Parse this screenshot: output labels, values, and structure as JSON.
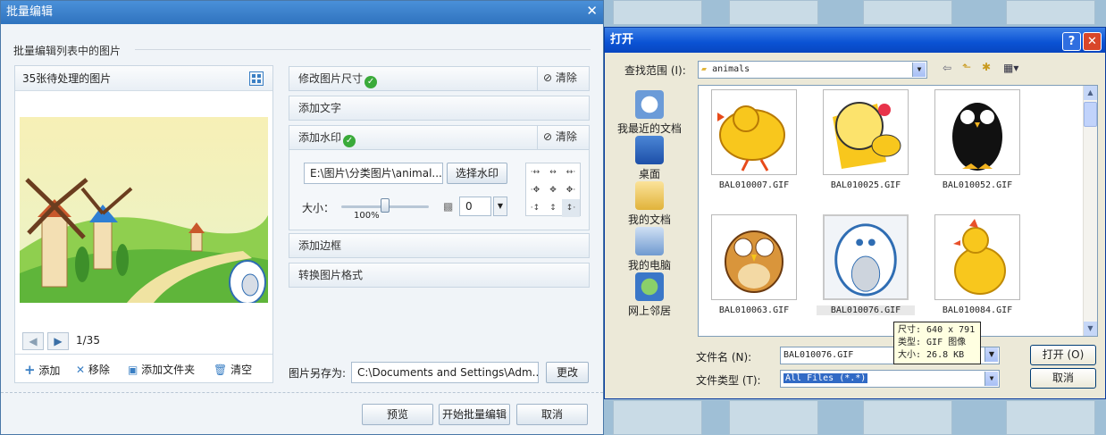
{
  "batch": {
    "title": "批量编辑",
    "section_label": "批量编辑列表中的图片",
    "list_header": "35张待处理的图片",
    "pager": "1/35",
    "actions": {
      "add": "添加",
      "remove": "移除",
      "add_folder": "添加文件夹",
      "clear": "清空"
    },
    "ops": {
      "resize": "修改图片尺寸",
      "add_text": "添加文字",
      "watermark": "添加水印",
      "border": "添加边框",
      "convert": "转换图片格式",
      "clear_label": "清除"
    },
    "watermark": {
      "path": "E:\\图片\\分类图片\\animal...",
      "choose_button": "选择水印",
      "size_label": "大小：",
      "size_percent": "100%",
      "slider_fraction": 0.5,
      "opacity_value": "0"
    },
    "save": {
      "label": "图片另存为:",
      "path": "C:\\Documents and Settings\\Adm...",
      "change_button": "更改"
    },
    "footer": {
      "preview": "预览",
      "start": "开始批量编辑",
      "cancel": "取消"
    }
  },
  "open_dialog": {
    "title": "打开",
    "lookin_label": "查找范围 (I):",
    "folder": "animals",
    "places": [
      "我最近的文档",
      "桌面",
      "我的文档",
      "我的电脑",
      "网上邻居"
    ],
    "files": [
      "BAL010007.GIF",
      "BAL010025.GIF",
      "BAL010052.GIF",
      "BAL010063.GIF",
      "BAL010076.GIF",
      "BAL010084.GIF"
    ],
    "tooltip": {
      "size": "尺寸: 640 x 791",
      "type": "类型: GIF 图像",
      "filesize": "大小: 26.8 KB"
    },
    "filename_label": "文件名 (N):",
    "filename_value": "BAL010076.GIF",
    "filetype_label": "文件类型 (T):",
    "filetype_value": "All Files (*.*)",
    "open_button": "打开 (O)",
    "cancel_button": "取消"
  }
}
